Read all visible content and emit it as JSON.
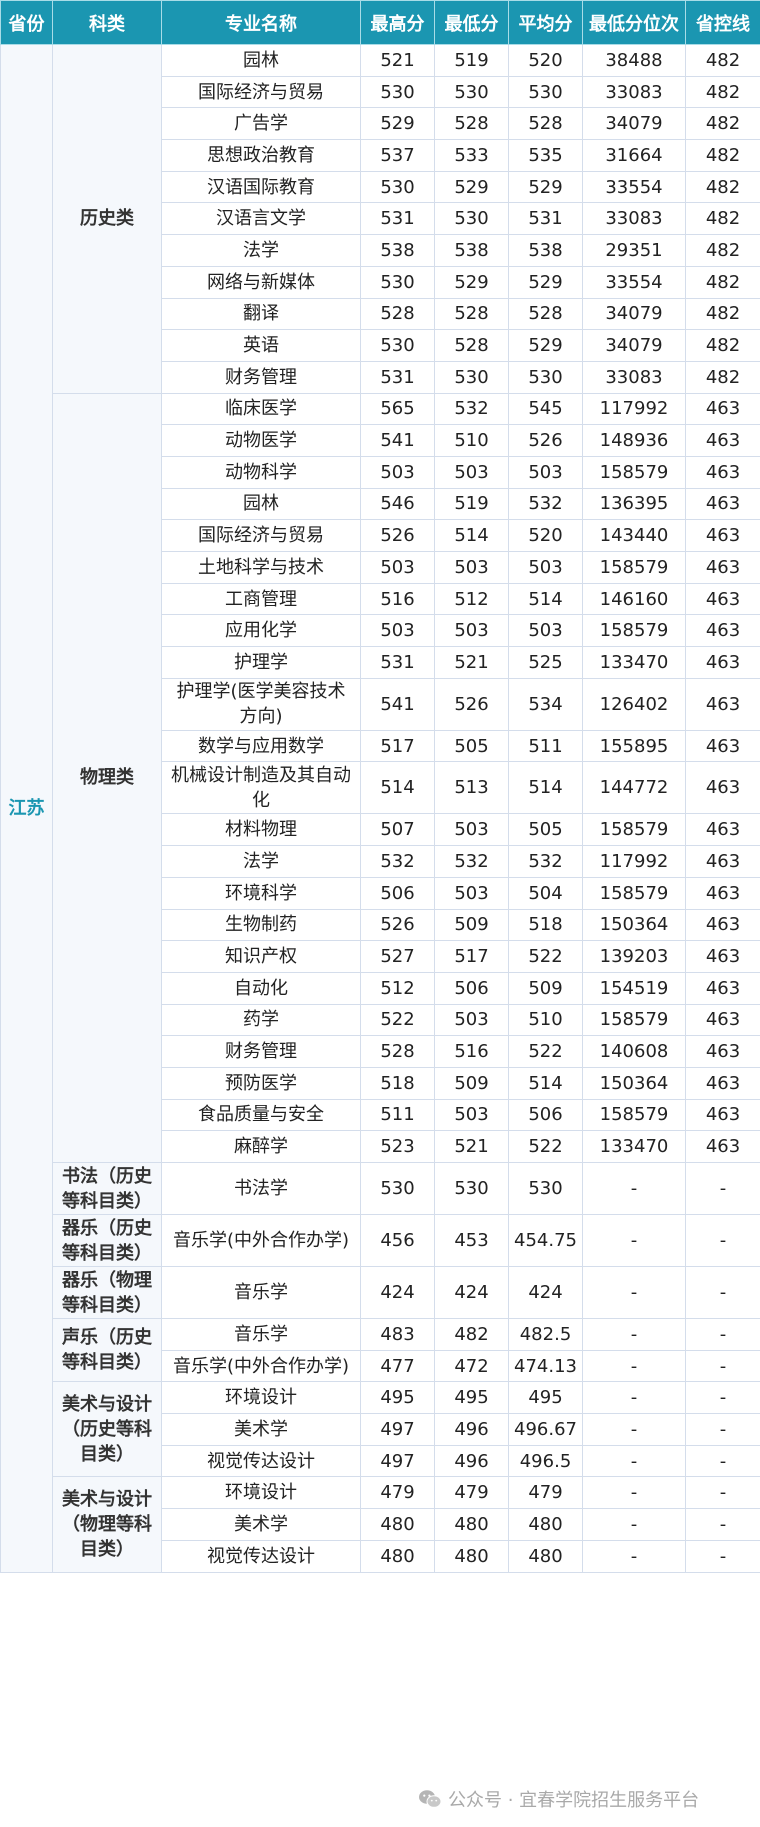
{
  "header": [
    "省份",
    "科类",
    "专业名称",
    "最高分",
    "最低分",
    "平均分",
    "最低分位次",
    "省控线"
  ],
  "province": "江苏",
  "groups": [
    {
      "category": "历史类",
      "rows": [
        [
          "园林",
          "521",
          "519",
          "520",
          "38488",
          "482"
        ],
        [
          "国际经济与贸易",
          "530",
          "530",
          "530",
          "33083",
          "482"
        ],
        [
          "广告学",
          "529",
          "528",
          "528",
          "34079",
          "482"
        ],
        [
          "思想政治教育",
          "537",
          "533",
          "535",
          "31664",
          "482"
        ],
        [
          "汉语国际教育",
          "530",
          "529",
          "529",
          "33554",
          "482"
        ],
        [
          "汉语言文学",
          "531",
          "530",
          "531",
          "33083",
          "482"
        ],
        [
          "法学",
          "538",
          "538",
          "538",
          "29351",
          "482"
        ],
        [
          "网络与新媒体",
          "530",
          "529",
          "529",
          "33554",
          "482"
        ],
        [
          "翻译",
          "528",
          "528",
          "528",
          "34079",
          "482"
        ],
        [
          "英语",
          "530",
          "528",
          "529",
          "34079",
          "482"
        ],
        [
          "财务管理",
          "531",
          "530",
          "530",
          "33083",
          "482"
        ]
      ]
    },
    {
      "category": "物理类",
      "rows": [
        [
          "临床医学",
          "565",
          "532",
          "545",
          "117992",
          "463"
        ],
        [
          "动物医学",
          "541",
          "510",
          "526",
          "148936",
          "463"
        ],
        [
          "动物科学",
          "503",
          "503",
          "503",
          "158579",
          "463"
        ],
        [
          "园林",
          "546",
          "519",
          "532",
          "136395",
          "463"
        ],
        [
          "国际经济与贸易",
          "526",
          "514",
          "520",
          "143440",
          "463"
        ],
        [
          "土地科学与技术",
          "503",
          "503",
          "503",
          "158579",
          "463"
        ],
        [
          "工商管理",
          "516",
          "512",
          "514",
          "146160",
          "463"
        ],
        [
          "应用化学",
          "503",
          "503",
          "503",
          "158579",
          "463"
        ],
        [
          "护理学",
          "531",
          "521",
          "525",
          "133470",
          "463"
        ],
        [
          "护理学(医学美容技术方向)",
          "541",
          "526",
          "534",
          "126402",
          "463"
        ],
        [
          "数学与应用数学",
          "517",
          "505",
          "511",
          "155895",
          "463"
        ],
        [
          "机械设计制造及其自动化",
          "514",
          "513",
          "514",
          "144772",
          "463"
        ],
        [
          "材料物理",
          "507",
          "503",
          "505",
          "158579",
          "463"
        ],
        [
          "法学",
          "532",
          "532",
          "532",
          "117992",
          "463"
        ],
        [
          "环境科学",
          "506",
          "503",
          "504",
          "158579",
          "463"
        ],
        [
          "生物制药",
          "526",
          "509",
          "518",
          "150364",
          "463"
        ],
        [
          "知识产权",
          "527",
          "517",
          "522",
          "139203",
          "463"
        ],
        [
          "自动化",
          "512",
          "506",
          "509",
          "154519",
          "463"
        ],
        [
          "药学",
          "522",
          "503",
          "510",
          "158579",
          "463"
        ],
        [
          "财务管理",
          "528",
          "516",
          "522",
          "140608",
          "463"
        ],
        [
          "预防医学",
          "518",
          "509",
          "514",
          "150364",
          "463"
        ],
        [
          "食品质量与安全",
          "511",
          "503",
          "506",
          "158579",
          "463"
        ],
        [
          "麻醉学",
          "523",
          "521",
          "522",
          "133470",
          "463"
        ]
      ]
    },
    {
      "category": "书法（历史等科目类）",
      "rows": [
        [
          "书法学",
          "530",
          "530",
          "530",
          "-",
          "-"
        ]
      ]
    },
    {
      "category": "器乐（历史等科目类）",
      "rows": [
        [
          "音乐学(中外合作办学)",
          "456",
          "453",
          "454.75",
          "-",
          "-"
        ]
      ]
    },
    {
      "category": "器乐（物理等科目类）",
      "rows": [
        [
          "音乐学",
          "424",
          "424",
          "424",
          "-",
          "-"
        ]
      ]
    },
    {
      "category": "声乐（历史等科目类）",
      "rows": [
        [
          "音乐学",
          "483",
          "482",
          "482.5",
          "-",
          "-"
        ],
        [
          "音乐学(中外合作办学)",
          "477",
          "472",
          "474.13",
          "-",
          "-"
        ]
      ]
    },
    {
      "category": "美术与设计（历史等科目类）",
      "rows": [
        [
          "环境设计",
          "495",
          "495",
          "495",
          "-",
          "-"
        ],
        [
          "美术学",
          "497",
          "496",
          "496.67",
          "-",
          "-"
        ],
        [
          "视觉传达设计",
          "497",
          "496",
          "496.5",
          "-",
          "-"
        ]
      ]
    },
    {
      "category": "美术与设计（物理等科目类）",
      "rows": [
        [
          "环境设计",
          "479",
          "479",
          "479",
          "-",
          "-"
        ],
        [
          "美术学",
          "480",
          "480",
          "480",
          "-",
          "-"
        ],
        [
          "视觉传达设计",
          "480",
          "480",
          "480",
          "-",
          "-"
        ]
      ]
    }
  ],
  "watermark": {
    "text": "公众号 · 宜春学院招生服务平台",
    "icon": "wechat-icon"
  },
  "colors": {
    "header_bg": "#1b96b1",
    "header_text": "#ffffff",
    "province_text": "#1b96b1",
    "label_bg": "#f5f8fc",
    "border": "#d4ddeb"
  }
}
